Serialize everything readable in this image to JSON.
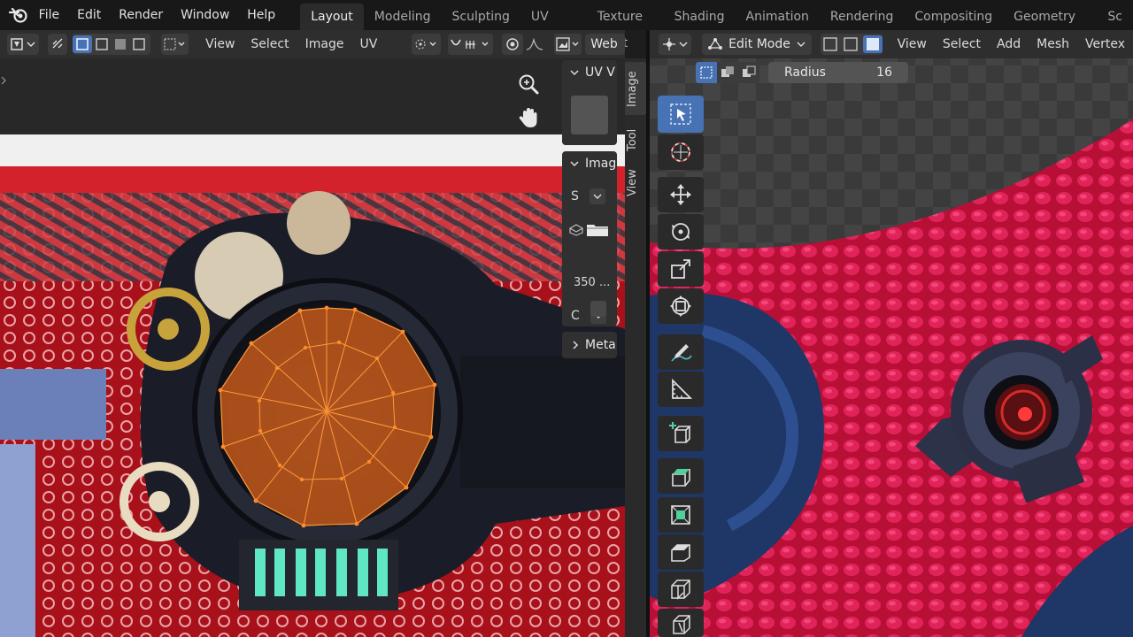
{
  "topbar": {
    "menu": [
      "File",
      "Edit",
      "Render",
      "Window",
      "Help"
    ],
    "workspaces": [
      "Layout",
      "Modeling",
      "Sculpting",
      "UV Editing",
      "Texture Paint",
      "Shading",
      "Animation",
      "Rendering",
      "Compositing",
      "Geometry Nodes",
      "Sc"
    ],
    "active_workspace": "Layout"
  },
  "uv_editor": {
    "header_menus": [
      "View",
      "Select",
      "Image",
      "UV"
    ],
    "web_label": "Web",
    "npanel": {
      "uv_title": "UV V",
      "image_title": "Imag",
      "source_label": "S",
      "size_value": "350 ...",
      "color_label": "C",
      "metadata_title": "Meta",
      "tabs": [
        "Image",
        "Tool",
        "View"
      ]
    }
  },
  "viewport": {
    "mode": "Edit Mode",
    "header_menus": [
      "View",
      "Select",
      "Add",
      "Mesh",
      "Vertex"
    ],
    "radius_label": "Radius",
    "radius_value": "16"
  },
  "colors": {
    "accent": "#4772b3",
    "uv_mesh": "#e07a1f",
    "canvas_red": "#b8121c",
    "mesh_red": "#c8123f"
  },
  "icons": [
    "blender-logo",
    "zoom-icon",
    "hand-icon",
    "select-box-icon",
    "cursor-icon",
    "move-icon",
    "rotate-icon",
    "scale-icon",
    "transform-icon",
    "annotate-icon",
    "measure-icon",
    "add-cube-icon",
    "extrude-icon",
    "inset-icon",
    "bevel-icon",
    "loopcut-icon",
    "knife-icon"
  ]
}
